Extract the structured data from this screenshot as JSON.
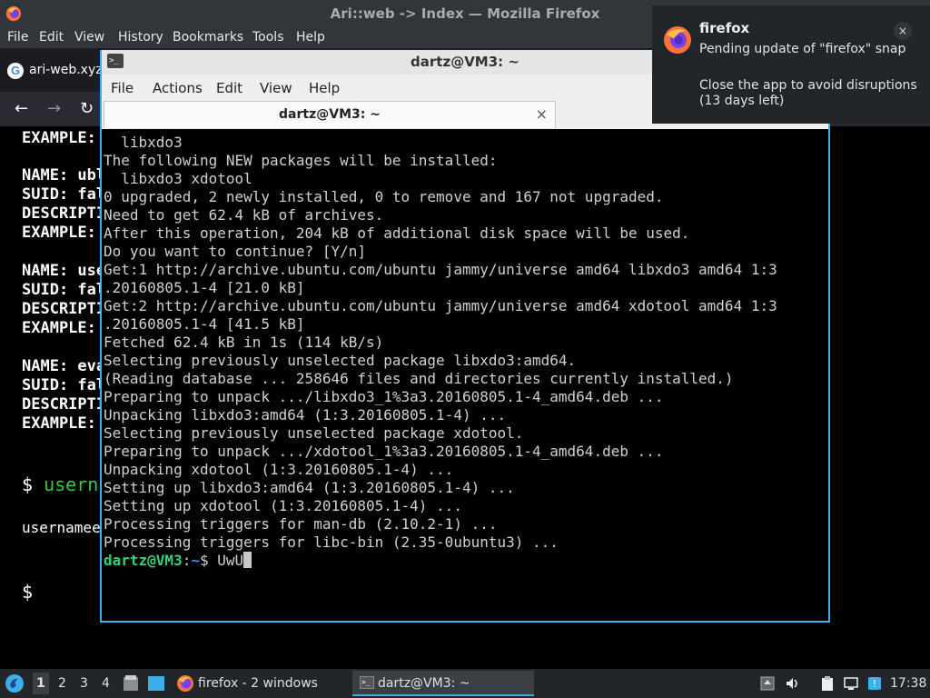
{
  "firefox": {
    "window_title": "Ari::web -> Index — Mozilla Firefox",
    "menu": [
      "File",
      "Edit",
      "View",
      "History",
      "Bookmarks",
      "Tools",
      "Help"
    ],
    "tab_label": "ari-web.xyz",
    "nav_icons": [
      "back-icon",
      "forward-icon",
      "reload-icon"
    ],
    "content": {
      "lines": [
        "EXAMPLE:",
        "NAME: ubl",
        "SUID: fal",
        "DESCRIPTI",
        "EXAMPLE:",
        "NAME: use",
        "SUID: fal",
        "DESCRIPTI",
        "EXAMPLE:",
        "NAME: eva",
        "SUID: fal",
        "DESCRIPTI",
        "EXAMPLE:"
      ],
      "prompt_symbol": "$",
      "prompt_cmd": "usern",
      "output": "usernamee",
      "prompt2": "$"
    }
  },
  "terminal": {
    "window_title": "dartz@VM3: ~",
    "menu": [
      "File",
      "Actions",
      "Edit",
      "View",
      "Help"
    ],
    "tab_label": "dartz@VM3: ~",
    "tab_close": "×",
    "lines": [
      "  libxdo3",
      "The following NEW packages will be installed:",
      "  libxdo3 xdotool",
      "0 upgraded, 2 newly installed, 0 to remove and 167 not upgraded.",
      "Need to get 62.4 kB of archives.",
      "After this operation, 204 kB of additional disk space will be used.",
      "Do you want to continue? [Y/n]",
      "Get:1 http://archive.ubuntu.com/ubuntu jammy/universe amd64 libxdo3 amd64 1:3",
      ".20160805.1-4 [21.0 kB]",
      "Get:2 http://archive.ubuntu.com/ubuntu jammy/universe amd64 xdotool amd64 1:3",
      ".20160805.1-4 [41.5 kB]",
      "Fetched 62.4 kB in 1s (114 kB/s)",
      "Selecting previously unselected package libxdo3:amd64.",
      "(Reading database ... 258646 files and directories currently installed.)",
      "Preparing to unpack .../libxdo3_1%3a3.20160805.1-4_amd64.deb ...",
      "Unpacking libxdo3:amd64 (1:3.20160805.1-4) ...",
      "Selecting previously unselected package xdotool.",
      "Preparing to unpack .../xdotool_1%3a3.20160805.1-4_amd64.deb ...",
      "Unpacking xdotool (1:3.20160805.1-4) ...",
      "Setting up libxdo3:amd64 (1:3.20160805.1-4) ...",
      "Setting up xdotool (1:3.20160805.1-4) ...",
      "Processing triggers for man-db (2.10.2-1) ...",
      "Processing triggers for libc-bin (2.35-0ubuntu3) ..."
    ],
    "prompt_user": "dartz@VM3",
    "prompt_sep": ":",
    "prompt_path": "~",
    "prompt_dollar": "$ ",
    "current_input": "UwU"
  },
  "notification": {
    "app": "firefox",
    "message": "Pending update of \"firefox\" snap",
    "detail": "Close the app to avoid disruptions (13 days left)",
    "close": "×"
  },
  "taskbar": {
    "workspaces": [
      "1",
      "2",
      "3",
      "4"
    ],
    "active_workspace": "1",
    "tasks": [
      {
        "label": "firefox - 2 windows",
        "icon": "firefox-icon"
      },
      {
        "label": "dartz@VM3: ~",
        "icon": "terminal-icon"
      }
    ],
    "tray_icons": [
      "updates-icon",
      "volume-icon",
      "clipboard-icon",
      "network-icon",
      "notification-icon"
    ],
    "clock": "17:38"
  },
  "colors": {
    "accent": "#3daee9",
    "prompt_green": "#33d17a",
    "prompt_blue": "#3b8eea",
    "panel_dark": "#232629"
  }
}
